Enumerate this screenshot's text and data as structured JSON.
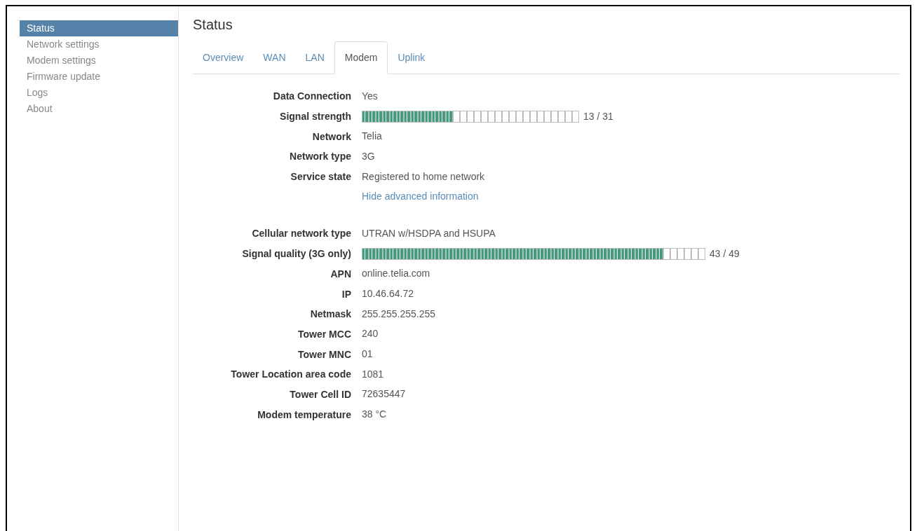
{
  "sidebar": {
    "items": [
      {
        "label": "Status",
        "selected": true
      },
      {
        "label": "Network settings",
        "selected": false
      },
      {
        "label": "Modem settings",
        "selected": false
      },
      {
        "label": "Firmware update",
        "selected": false
      },
      {
        "label": "Logs",
        "selected": false
      },
      {
        "label": "About",
        "selected": false
      }
    ]
  },
  "page_title": "Status",
  "tabs": [
    {
      "label": "Overview",
      "selected": false
    },
    {
      "label": "WAN",
      "selected": false
    },
    {
      "label": "LAN",
      "selected": false
    },
    {
      "label": "Modem",
      "selected": true
    },
    {
      "label": "Uplink",
      "selected": false
    }
  ],
  "sections": [
    {
      "rows": [
        {
          "kind": "text",
          "label": "Data Connection",
          "value": "Yes"
        },
        {
          "kind": "meter",
          "label": "Signal strength",
          "level": 0.4194,
          "reading": "13 / 31"
        },
        {
          "kind": "text",
          "label": "Network",
          "value": "Telia"
        },
        {
          "kind": "text",
          "label": "Network type",
          "value": "3G"
        },
        {
          "kind": "text",
          "label": "Service state",
          "value": "Registered to home network"
        },
        {
          "kind": "link",
          "value": "Hide advanced information"
        }
      ]
    },
    {
      "rows": [
        {
          "kind": "text",
          "label": "Cellular network type",
          "value": "UTRAN w/HSDPA and HSUPA"
        },
        {
          "kind": "meter",
          "label": "Signal quality (3G only)",
          "level": 0.8776,
          "reading": "43 / 49"
        },
        {
          "kind": "text",
          "label": "APN",
          "value": "online.telia.com"
        },
        {
          "kind": "text",
          "label": "IP",
          "value": "10.46.64.72"
        },
        {
          "kind": "text",
          "label": "Netmask",
          "value": "255.255.255.255"
        },
        {
          "kind": "text",
          "label": "Tower MCC",
          "value": "240"
        },
        {
          "kind": "text",
          "label": "Tower MNC",
          "value": "01"
        },
        {
          "kind": "text",
          "label": "Tower Location area code",
          "value": "1081"
        },
        {
          "kind": "text",
          "label": "Tower Cell ID",
          "value": "72635447"
        },
        {
          "kind": "text",
          "label": "Modem temperature",
          "value": "38 °C"
        }
      ]
    }
  ]
}
